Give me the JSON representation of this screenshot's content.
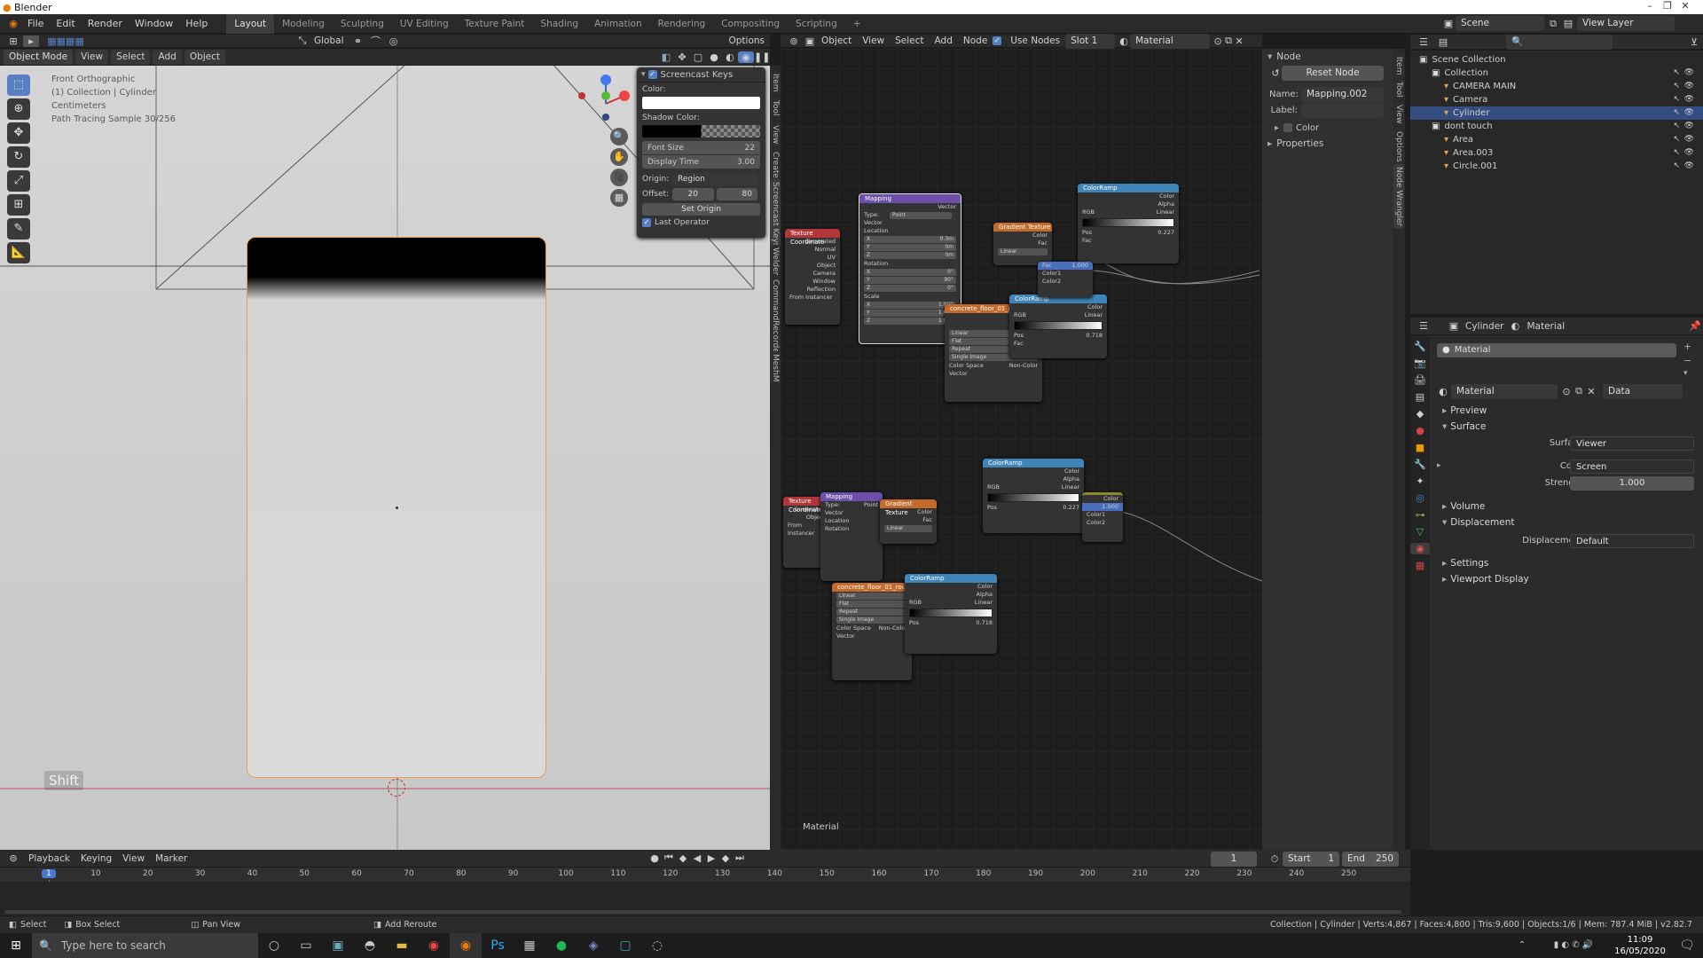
{
  "app": {
    "title": "Blender"
  },
  "window_controls": {
    "minimize": "–",
    "maximize": "❐",
    "close": "✕"
  },
  "menu": [
    "File",
    "Edit",
    "Render",
    "Window",
    "Help"
  ],
  "workspaces": [
    "Layout",
    "Modeling",
    "Sculpting",
    "UV Editing",
    "Texture Paint",
    "Shading",
    "Animation",
    "Rendering",
    "Compositing",
    "Scripting"
  ],
  "active_workspace": "Layout",
  "scene": {
    "label": "Scene",
    "view_layer": "View Layer"
  },
  "viewport_header": {
    "mode": "Object Mode",
    "menus": [
      "View",
      "Select",
      "Add",
      "Object"
    ],
    "transform": "Global",
    "options": "Options"
  },
  "viewport_info": [
    "Front Orthographic",
    "(1) Collection | Cylinder",
    "Centimeters",
    "Path Tracing Sample 30/256"
  ],
  "key_overlay": "Shift",
  "screencast_panel": {
    "title": "Screencast Keys",
    "color_label": "Color:",
    "shadow_label": "Shadow Color:",
    "font_size_label": "Font Size",
    "font_size": "22",
    "display_time_label": "Display Time",
    "display_time": "3.00",
    "origin_label": "Origin:",
    "origin_value": "Region",
    "offset_label": "Offset:",
    "offset_x": "20",
    "offset_y": "80",
    "set_origin": "Set Origin",
    "last_operator": "Last Operator"
  },
  "side_tabs": [
    "Item",
    "Tool",
    "View",
    "Create",
    "Screencast Keys",
    "Welder",
    "CommandRecorder",
    "MeshM"
  ],
  "node_header": {
    "object": "Object",
    "menus": [
      "View",
      "Select",
      "Add",
      "Node"
    ],
    "use_nodes": "Use Nodes",
    "slot": "Slot 1",
    "material": "Material"
  },
  "node_editor_label": "Material",
  "nodes": {
    "texcoord": "Texture Coordinate",
    "mapping": "Mapping",
    "gradient": "Gradient Texture",
    "colorramp": "ColorRamp",
    "image": "concrete_floor_01_rou",
    "outputs": [
      "Generated",
      "Normal",
      "UV",
      "Object",
      "Camera",
      "Window",
      "Reflection"
    ],
    "type_label": "Type:",
    "type_value": "Point",
    "vector": "Vector",
    "location": "Location",
    "rotation": "Rotation",
    "scale": "Scale",
    "loc_x": "0.3m",
    "loc_y": "0m",
    "loc_z": "0m",
    "rot_x": "0°",
    "rot_y": "90°",
    "rot_z": "0°",
    "scale_x": "1.000",
    "scale_y": "1.000",
    "scale_z": "1.000",
    "color": "Color",
    "alpha": "Alpha",
    "fac": "Fac",
    "linear": "Linear",
    "rgb": "RGB",
    "pos": "Pos",
    "pos_value": "0.227",
    "pos_value2": "0.718",
    "flat": "Flat",
    "repeat": "Repeat",
    "single_image": "Single Image",
    "color_space": "Color Space",
    "non_color": "Non-Color",
    "from_instancer": "From Instancer",
    "color1": "Color1",
    "color2": "Color2",
    "mix_value": "1.000"
  },
  "node_sidebar": {
    "section": "Node",
    "reset": "Reset Node",
    "name_label": "Name:",
    "name_value": "Mapping.002",
    "label_label": "Label:",
    "color": "Color",
    "properties": "Properties"
  },
  "node_side_tabs": [
    "Item",
    "Tool",
    "View",
    "Options",
    "Node Wrangler"
  ],
  "outliner": {
    "scene_collection": "Scene Collection",
    "items": [
      {
        "name": "Collection",
        "indent": 1
      },
      {
        "name": "CAMERA MAIN",
        "indent": 2
      },
      {
        "name": "Camera",
        "indent": 2
      },
      {
        "name": "Cylinder",
        "indent": 2,
        "selected": true
      },
      {
        "name": "dont touch",
        "indent": 1
      },
      {
        "name": "Area",
        "indent": 2
      },
      {
        "name": "Area.003",
        "indent": 2
      },
      {
        "name": "Circle.001",
        "indent": 2
      }
    ]
  },
  "properties": {
    "object": "Cylinder",
    "material_tab": "Material",
    "slot_material": "Material",
    "material_name": "Material",
    "data": "Data",
    "sections": [
      "Preview",
      "Surface",
      "Volume",
      "Displacement",
      "Settings",
      "Viewport Display"
    ],
    "surface_label": "Surface",
    "surface_value": "Viewer",
    "color_label": "Color",
    "color_value": "Screen",
    "strength_label": "Strength",
    "strength_value": "1.000",
    "displacement_label": "Displacement",
    "displacement_value": "Default"
  },
  "timeline": {
    "menus": [
      "Playback",
      "Keying",
      "View",
      "Marker"
    ],
    "current_frame": "1",
    "start_label": "Start",
    "start": "1",
    "end_label": "End",
    "end": "250",
    "ticks": [
      "1",
      "10",
      "20",
      "30",
      "40",
      "50",
      "60",
      "70",
      "80",
      "90",
      "100",
      "110",
      "120",
      "130",
      "140",
      "150",
      "160",
      "170",
      "180",
      "190",
      "200",
      "210",
      "220",
      "230",
      "240",
      "250"
    ]
  },
  "statusbar": {
    "select": "Select",
    "box_select": "Box Select",
    "pan_view": "Pan View",
    "add_reroute": "Add Reroute",
    "stats": "Collection | Cylinder | Verts:4,867 | Faces:4,800 | Tris:9,600 | Objects:1/6 | Mem: 787.4 MiB | v2.82.7"
  },
  "taskbar": {
    "search_placeholder": "Type here to search",
    "time": "11:09",
    "date": "16/05/2020"
  }
}
